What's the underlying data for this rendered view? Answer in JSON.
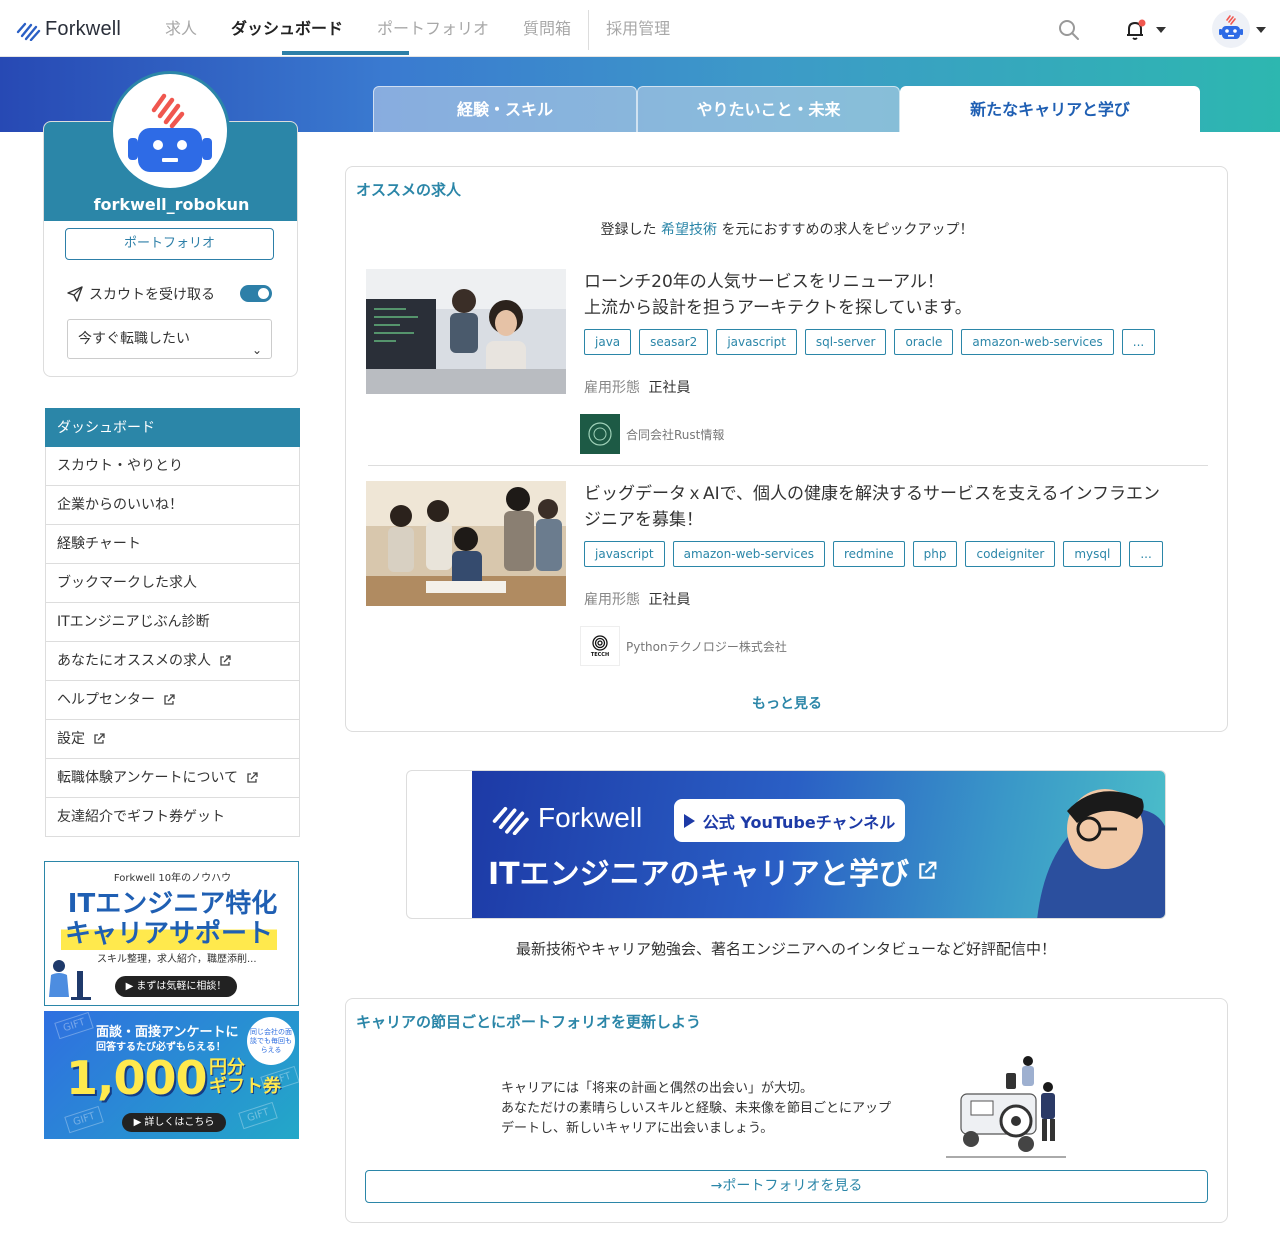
{
  "header": {
    "logo_text": "Forkwell",
    "nav": [
      "求人",
      "ダッシュボード",
      "ポートフォリオ",
      "質問箱",
      "採用管理"
    ],
    "active_nav": "ダッシュボード"
  },
  "profile": {
    "username": "forkwell_robokun",
    "portfolio_button": "ポートフォリオ",
    "scout_label": "スカウトを受け取る",
    "scout_enabled": true,
    "job_status": "今すぐ転職したい"
  },
  "side_menu": {
    "items": [
      {
        "label": "ダッシュボード",
        "external": false
      },
      {
        "label": "スカウト・やりとり",
        "external": false
      },
      {
        "label": "企業からのいいね！",
        "external": false
      },
      {
        "label": "経験チャート",
        "external": false
      },
      {
        "label": "ブックマークした求人",
        "external": false
      },
      {
        "label": "ITエンジニアじぶん診断",
        "external": false
      },
      {
        "label": "あなたにオススメの求人",
        "external": true
      },
      {
        "label": "ヘルプセンター",
        "external": true
      },
      {
        "label": "設定",
        "external": true
      },
      {
        "label": "転職体験アンケートについて",
        "external": true
      },
      {
        "label": "友達紹介でギフト券ゲット",
        "external": false
      }
    ]
  },
  "ads": {
    "career_support": {
      "top": "Forkwell 10年のノウハウ",
      "line1": "ITエンジニア特化",
      "line2": "キャリアサポート",
      "sub": "スキル整理，求人紹介，職歴添削...",
      "button": "▶ まずは気軽に相談！"
    },
    "gift": {
      "line1": "面談・面接アンケートに",
      "line2": "回答するたび必ずもらえる！",
      "badge": "同じ会社の面談でも毎回もらえる",
      "amount": "1,000",
      "unit1": "円分",
      "unit2": "ギフト券",
      "button": "▶ 詳しくはこちら",
      "gift_word": "GIFT"
    }
  },
  "tabs": [
    "経験・スキル",
    "やりたいこと・未来",
    "新たなキャリアと学び"
  ],
  "recommend": {
    "title": "オススメの求人",
    "intro_before": "登録した",
    "intro_highlight": "希望技術",
    "intro_after": "を元におすすめの求人をピックアップ！",
    "jobs": [
      {
        "title_line1": "ローンチ20年の人気サービスをリニューアル！",
        "title_line2": "上流から設計を担うアーキテクトを探しています。",
        "tags": [
          "java",
          "seasar2",
          "javascript",
          "sql-server",
          "oracle",
          "amazon-web-services",
          "..."
        ],
        "employment_label": "雇用形態",
        "employment_value": "正社員",
        "company": "合同会社Rust情報"
      },
      {
        "title_line1": "ビッグデータｘAIで、個人の健康を解決するサービスを支えるインフラエン",
        "title_line2": "ジニアを募集！",
        "tags": [
          "javascript",
          "amazon-web-services",
          "redmine",
          "php",
          "codeigniter",
          "mysql",
          "..."
        ],
        "employment_label": "雇用形態",
        "employment_value": "正社員",
        "company": "Pythonテクノロジー株式会社",
        "company_logo_text": "TECCH"
      }
    ],
    "more": "もっと見る"
  },
  "youtube": {
    "logo_text": "Forkwell",
    "button": "公式 YouTubeチャンネル",
    "title": "ITエンジニアのキャリアと学び",
    "caption": "最新技術やキャリア勉強会、著名エンジニアへのインタビューなど好評配信中！"
  },
  "career": {
    "title": "キャリアの節目ごとにポートフォリオを更新しよう",
    "text_line1": "キャリアには「将来の計画と偶然の出会い」が大切。",
    "text_line2": "あなただけの素晴らしいスキルと経験、未来像を節目ごとにアップ",
    "text_line3": "デートし、新しいキャリアに出会いましょう。",
    "button": "→ポートフォリオを見る"
  },
  "colors": {
    "accent": "#2b86a8",
    "brand_blue": "#1f5fb3",
    "robot_blue": "#2e6be6",
    "robot_red": "#f0574f"
  }
}
